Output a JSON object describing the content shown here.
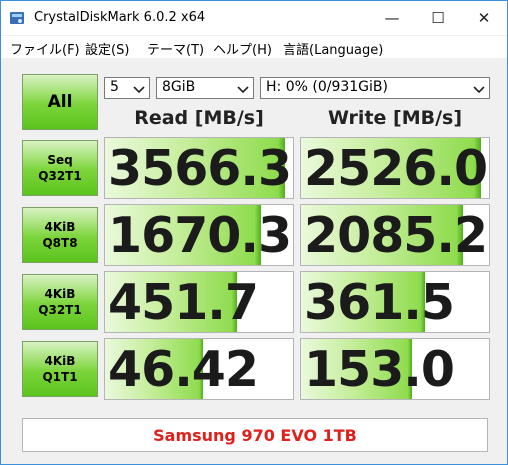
{
  "window": {
    "title": "CrystalDiskMark 6.0.2 x64",
    "controls": {
      "minimize": "—",
      "maximize": "☐",
      "close": "✕"
    }
  },
  "menu": [
    "ファイル(F)",
    "設定(S)",
    "テーマ(T)",
    "ヘルプ(H)",
    "言語(Language)"
  ],
  "controls": {
    "all_label": "All",
    "count": "5",
    "size": "8GiB",
    "drive": "H: 0% (0/931GiB)"
  },
  "headers": {
    "read": "Read [MB/s]",
    "write": "Write [MB/s]"
  },
  "rows": [
    {
      "line1": "Seq",
      "line2": "Q32T1",
      "read": "3566.3",
      "write": "2526.0",
      "read_fill": 0.96,
      "write_fill": 0.96
    },
    {
      "line1": "4KiB",
      "line2": "Q8T8",
      "read": "1670.3",
      "write": "2085.2",
      "read_fill": 0.83,
      "write_fill": 0.86
    },
    {
      "line1": "4KiB",
      "line2": "Q32T1",
      "read": "451.7",
      "write": "361.5",
      "read_fill": 0.7,
      "write_fill": 0.66
    },
    {
      "line1": "4KiB",
      "line2": "Q1T1",
      "read": "46.42",
      "write": "153.0",
      "read_fill": 0.52,
      "write_fill": 0.59
    }
  ],
  "status_text": "Samsung 970 EVO 1TB",
  "colors": {
    "status_text": "#e0201b",
    "window_border": "#3c8fd8",
    "desktop": "#1c7fd0"
  }
}
